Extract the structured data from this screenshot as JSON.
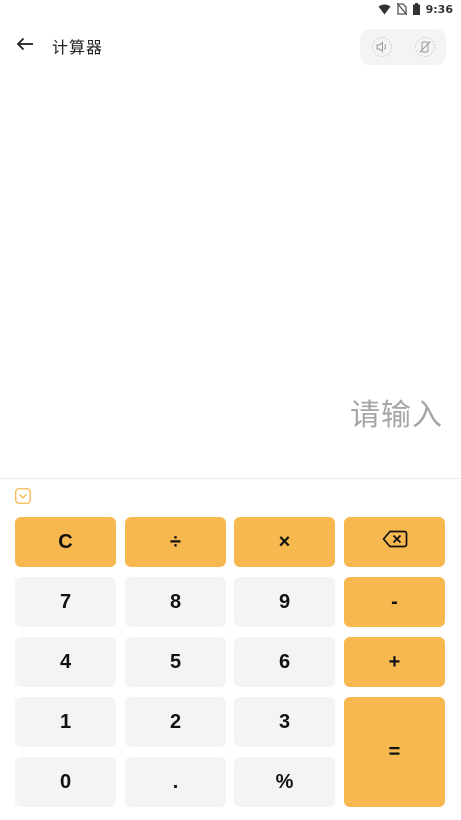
{
  "status_bar": {
    "time": "9:36",
    "icons": [
      "wifi-icon",
      "no-sim-icon",
      "battery-icon"
    ]
  },
  "app_bar": {
    "back_icon": "arrow-left-icon",
    "title": "计算器",
    "sound_icons": [
      "speaker-muted-icon",
      "vibration-off-icon"
    ]
  },
  "display": {
    "placeholder": "请输入"
  },
  "keypad": {
    "collapse_icon": "chevron-down-icon",
    "keys": {
      "clear": "C",
      "divide": "÷",
      "multiply": "×",
      "backspace_icon": "backspace-icon",
      "seven": "7",
      "eight": "8",
      "nine": "9",
      "minus": "-",
      "four": "4",
      "five": "5",
      "six": "6",
      "plus": "+",
      "one": "1",
      "two": "2",
      "three": "3",
      "equals": "=",
      "zero": "0",
      "dot": ".",
      "percent": "%"
    }
  },
  "colors": {
    "accent": "#f7b84f",
    "key_bg": "#f4f4f4",
    "placeholder_text": "#a6a6a6"
  }
}
